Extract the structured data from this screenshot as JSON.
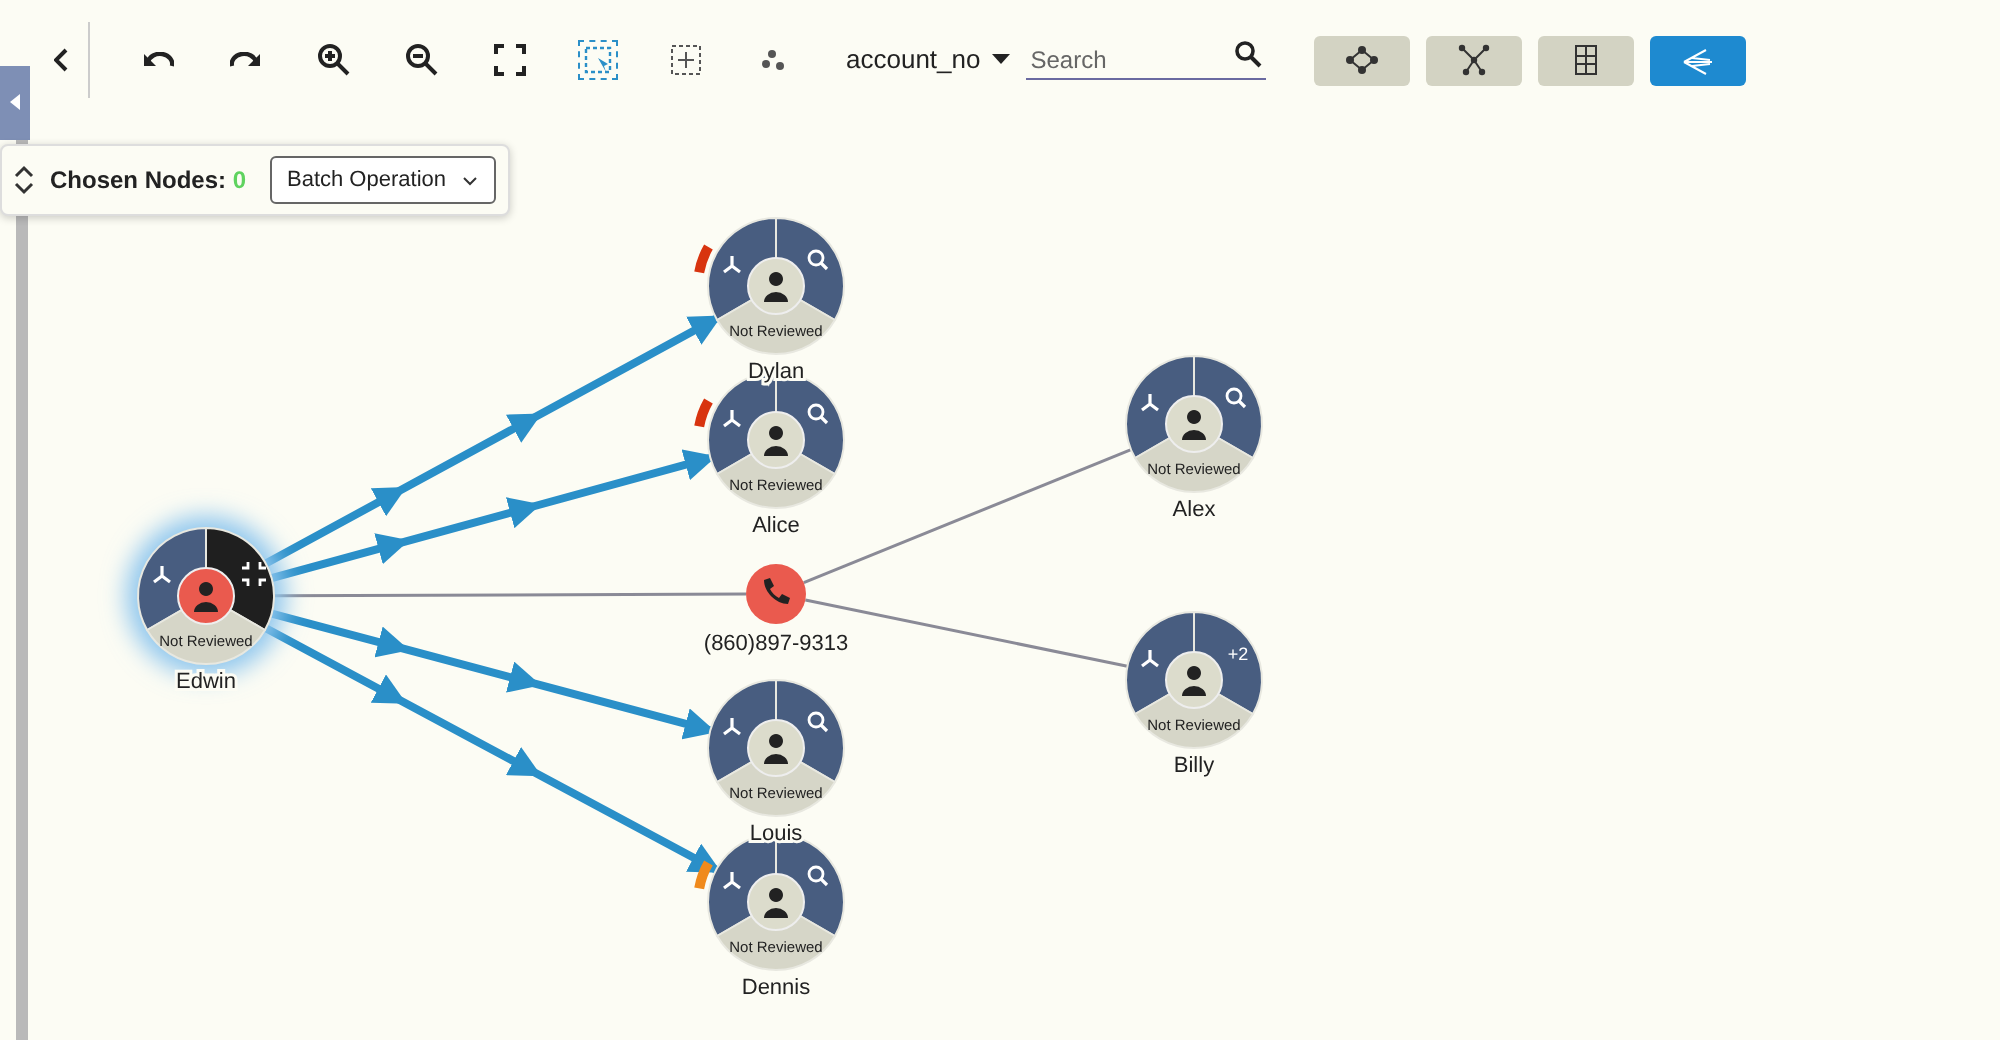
{
  "toolbar": {
    "tools": [
      {
        "kind": "back",
        "selected": false
      },
      {
        "kind": "undo",
        "selected": false
      },
      {
        "kind": "redo",
        "selected": false
      },
      {
        "kind": "zoom-in",
        "selected": false
      },
      {
        "kind": "zoom-out",
        "selected": false
      },
      {
        "kind": "fit",
        "selected": false
      },
      {
        "kind": "box-select",
        "selected": true
      },
      {
        "kind": "area-select",
        "selected": false
      },
      {
        "kind": "cluster",
        "selected": false
      }
    ],
    "field_selector": {
      "value": "account_no"
    },
    "search": {
      "placeholder": "Search"
    },
    "layouts": [
      {
        "kind": "force",
        "selected": false
      },
      {
        "kind": "tree",
        "selected": false
      },
      {
        "kind": "grid",
        "selected": false
      },
      {
        "kind": "hierarchy",
        "selected": true
      }
    ]
  },
  "selection_panel": {
    "label": "Chosen Nodes:",
    "count": "0",
    "batch_button": "Batch Operation"
  },
  "graph": {
    "nodes": [
      {
        "kind": "person",
        "label": "Edwin",
        "status": "Not Reviewed",
        "selected": true,
        "action": {
          "kind": "collapse"
        }
      },
      {
        "kind": "person",
        "label": "Dylan",
        "status": "Not Reviewed",
        "selected": false,
        "action": {
          "kind": "search"
        },
        "color": "#d8340f",
        "edge": {
          "kind": "flow"
        }
      },
      {
        "kind": "person",
        "label": "Alice",
        "status": "Not Reviewed",
        "selected": false,
        "action": {
          "kind": "search"
        },
        "color": "#d8340f",
        "edge": {
          "kind": "flow"
        }
      },
      {
        "kind": "phone",
        "label": "(860)897-9313",
        "edge": {
          "kind": "link"
        }
      },
      {
        "kind": "person",
        "label": "Alex",
        "status": "Not Reviewed",
        "selected": false,
        "action": {
          "kind": "search"
        },
        "edge": {
          "kind": "link"
        }
      },
      {
        "kind": "person",
        "label": "Billy",
        "status": "Not Reviewed",
        "selected": false,
        "action": {
          "kind": "count",
          "text": "+2"
        },
        "edge": {
          "kind": "link"
        }
      },
      {
        "kind": "person",
        "label": "Louis",
        "status": "Not Reviewed",
        "selected": false,
        "action": {
          "kind": "search"
        },
        "edge": {
          "kind": "flow"
        }
      },
      {
        "kind": "person",
        "label": "Dennis",
        "status": "Not Reviewed",
        "selected": false,
        "action": {
          "kind": "search"
        },
        "color": "#f08a1c",
        "edge": {
          "kind": "flow"
        }
      }
    ]
  }
}
